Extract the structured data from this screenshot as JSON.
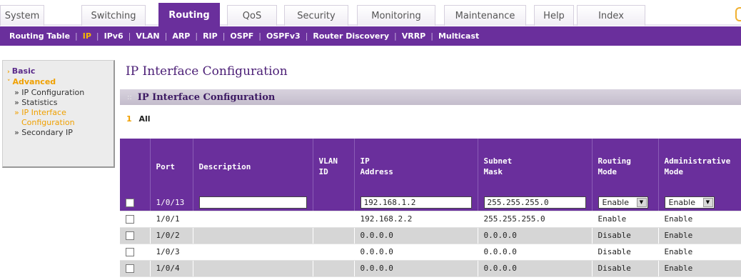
{
  "top_tabs": [
    "System",
    "Switching",
    "Routing",
    "QoS",
    "Security",
    "Monitoring",
    "Maintenance",
    "Help",
    "Index"
  ],
  "active_top_tab": "Routing",
  "sub_menu": [
    "Routing Table",
    "IP",
    "IPv6",
    "VLAN",
    "ARP",
    "RIP",
    "OSPF",
    "OSPFv3",
    "Router Discovery",
    "VRRP",
    "Multicast"
  ],
  "active_sub": "IP",
  "sidebar": {
    "basic": "Basic",
    "advanced": "Advanced",
    "items": [
      "» IP Configuration",
      "» Statistics",
      "» IP Interface",
      "Configuration",
      "» Secondary IP"
    ]
  },
  "page_title": "IP Interface Configuration",
  "section_title": "IP Interface Configuration",
  "filter": {
    "number": "1",
    "label": "All"
  },
  "table": {
    "headers": {
      "port": "Port",
      "description": "Description",
      "vlan_1": "VLAN",
      "vlan_2": "ID",
      "ip_1": "IP",
      "ip_2": "Address",
      "subnet_1": "Subnet",
      "subnet_2": "Mask",
      "routing_1": "Routing",
      "routing_2": "Mode",
      "admin_1": "Administrative",
      "admin_2": "Mode"
    },
    "edit_row": {
      "port": "1/0/13",
      "description": "",
      "ip": "192.168.1.2",
      "mask": "255.255.255.0",
      "routing_mode": "Enable",
      "admin_mode": "Enable"
    },
    "rows": [
      {
        "port": "1/0/1",
        "description": "",
        "vlan": "",
        "ip": "192.168.2.2",
        "mask": "255.255.255.0",
        "routing": "Enable",
        "admin": "Enable"
      },
      {
        "port": "1/0/2",
        "description": "",
        "vlan": "",
        "ip": "0.0.0.0",
        "mask": "0.0.0.0",
        "routing": "Disable",
        "admin": "Enable"
      },
      {
        "port": "1/0/3",
        "description": "",
        "vlan": "",
        "ip": "0.0.0.0",
        "mask": "0.0.0.0",
        "routing": "Disable",
        "admin": "Enable"
      },
      {
        "port": "1/0/4",
        "description": "",
        "vlan": "",
        "ip": "0.0.0.0",
        "mask": "0.0.0.0",
        "routing": "Disable",
        "admin": "Enable"
      }
    ]
  },
  "colors": {
    "brand_purple": "#6a2f9c",
    "accent_orange": "#f0a000",
    "row_gray": "#d6d6d6"
  }
}
